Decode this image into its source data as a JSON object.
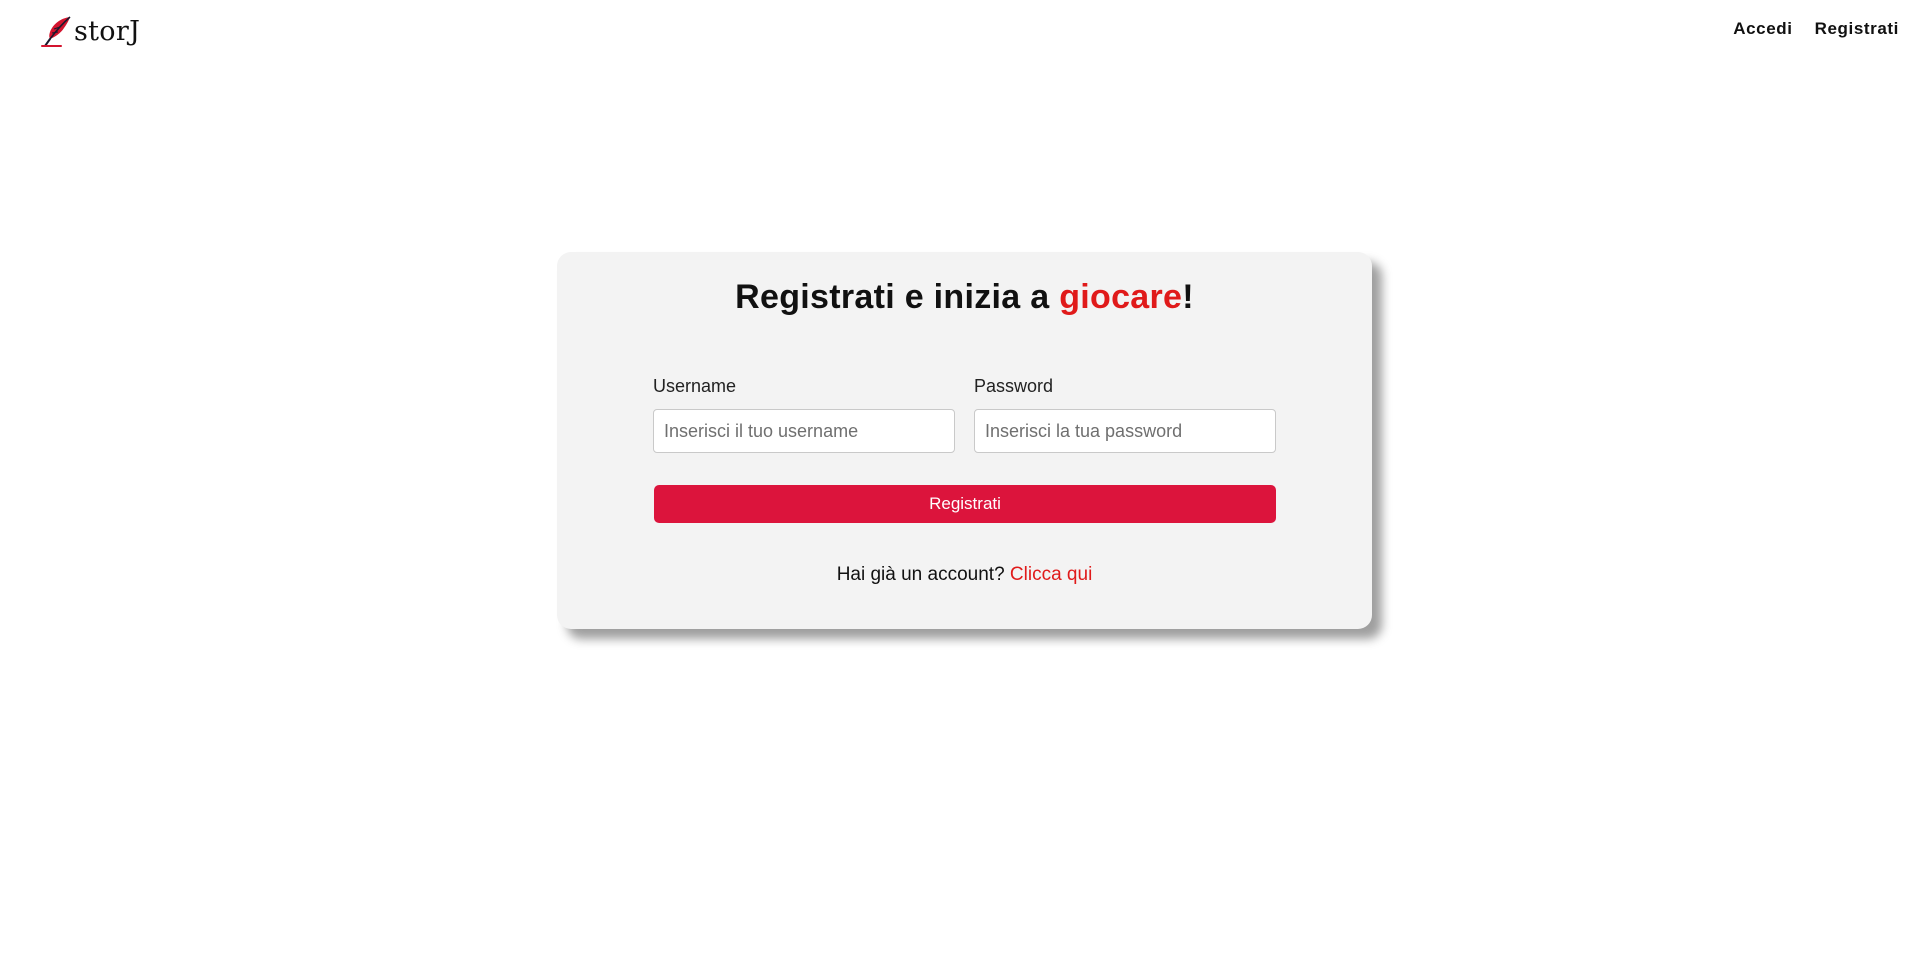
{
  "brand": {
    "name": "storJ",
    "icon": "quill-feather-icon"
  },
  "nav": {
    "login_label": "Accedi",
    "register_label": "Registrati"
  },
  "card": {
    "title_prefix": "Registrati e inizia a ",
    "title_accent": "giocare",
    "title_suffix": "!",
    "username": {
      "label": "Username",
      "placeholder": "Inserisci il tuo username",
      "value": ""
    },
    "password": {
      "label": "Password",
      "placeholder": "Inserisci la tua password",
      "value": ""
    },
    "submit_label": "Registrati",
    "login_prompt": "Hai già un account? ",
    "login_link_label": "Clicca qui"
  },
  "colors": {
    "accent_red": "#e01a1a",
    "button_crimson": "#dc143c",
    "card_background": "#f3f3f3",
    "page_background": "#ffffff"
  }
}
